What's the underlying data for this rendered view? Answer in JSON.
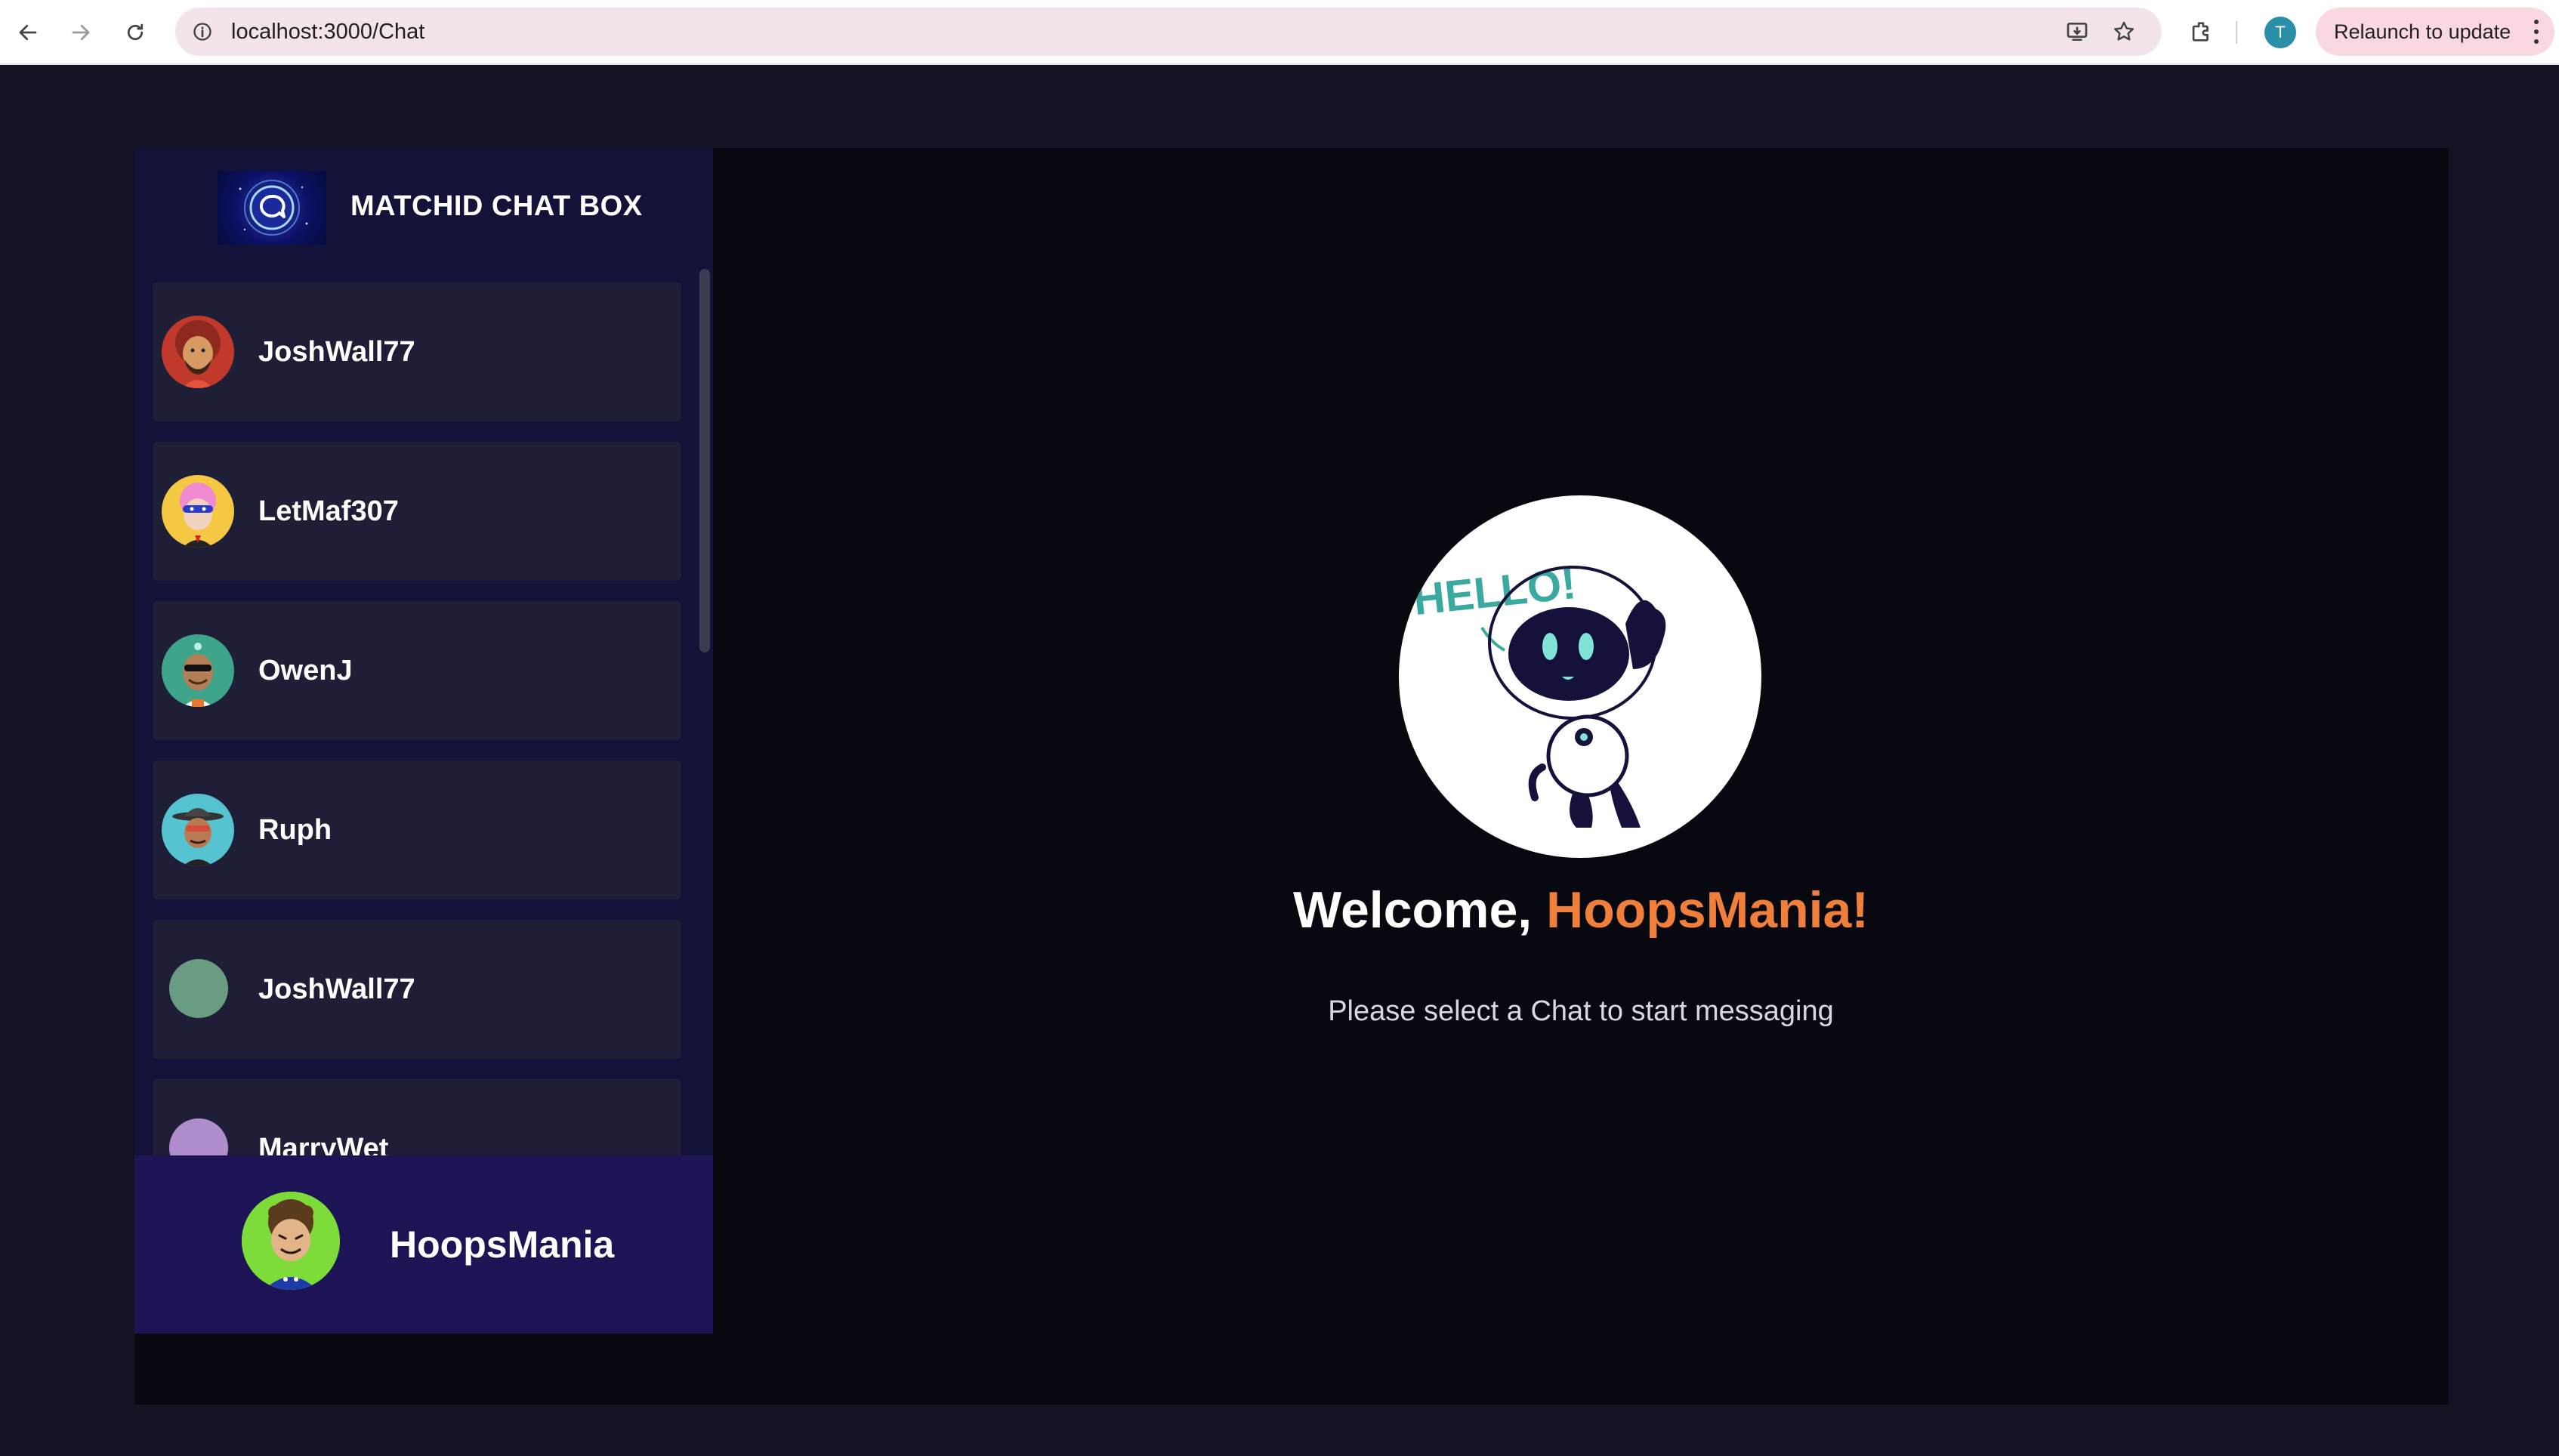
{
  "browser": {
    "url": "localhost:3000/Chat",
    "profile_initial": "T",
    "relaunch_label": "Relaunch to update"
  },
  "sidebar": {
    "brand_title": "MATCHID CHAT BOX",
    "contacts": [
      {
        "name": "JoshWall77",
        "avatar": "cartoon-avatar-red",
        "color": "#c0392b"
      },
      {
        "name": "LetMaf307",
        "avatar": "cartoon-avatar-yellow",
        "color": "#f4c842"
      },
      {
        "name": "OwenJ",
        "avatar": "cartoon-avatar-teal",
        "color": "#3fa58a"
      },
      {
        "name": "Ruph",
        "avatar": "cartoon-avatar-cyan",
        "color": "#55c4d0"
      },
      {
        "name": "JoshWall77",
        "avatar": "plain-circle",
        "color": "#6a9c82"
      },
      {
        "name": "MarryWet",
        "avatar": "plain-circle",
        "color": "#b08ccc"
      }
    ]
  },
  "current_user": {
    "name": "HoopsMania",
    "avatar": "cartoon-avatar-green"
  },
  "welcome": {
    "greeting": "Welcome,",
    "username": "HoopsMania!",
    "robot_caption": "HELLO!",
    "prompt": "Please select a Chat to start messaging"
  },
  "colors": {
    "accent": "#f07f3c",
    "page_bg": "#131324",
    "sidebar_bg": "#13133a",
    "card_bg": "#1e1f36",
    "current_user_bg": "#1c1454"
  }
}
